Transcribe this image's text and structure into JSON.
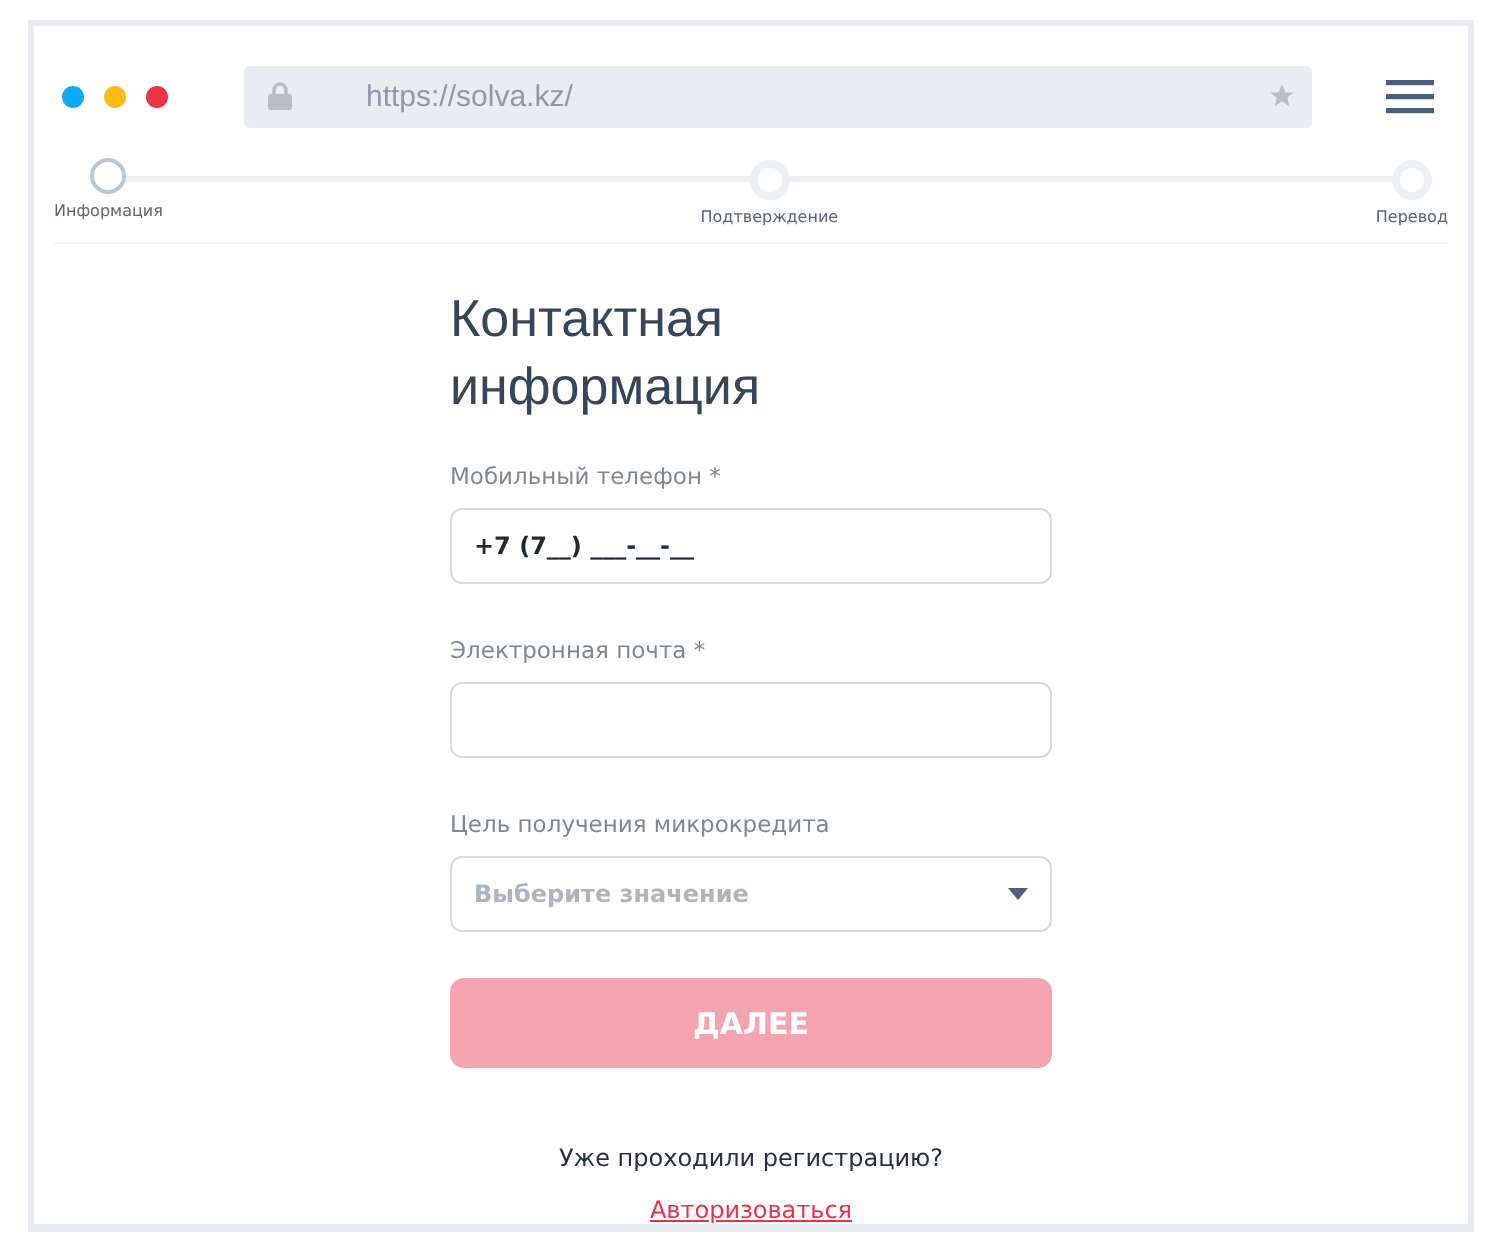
{
  "browser": {
    "url": "https://solva.kz/"
  },
  "steps": [
    {
      "label": "Информация",
      "selected": true
    },
    {
      "label": "Подтверждение",
      "selected": false
    },
    {
      "label": "Перевод",
      "selected": false
    }
  ],
  "form": {
    "title": "Контактная информация",
    "fields": [
      {
        "kind": "input",
        "label": "Мобильный телефон *",
        "value": "+7 (7__) ___-__-__"
      },
      {
        "kind": "input",
        "label": "Электронная почта *"
      },
      {
        "kind": "select",
        "label": "Цель получения микрокредита",
        "placeholder": "Выберите значение"
      }
    ],
    "submit": {
      "label": "ДАЛЕЕ",
      "disabled": true
    },
    "login_prompt": "Уже проходили регистрацию?",
    "login_link": "Авторизоваться"
  }
}
